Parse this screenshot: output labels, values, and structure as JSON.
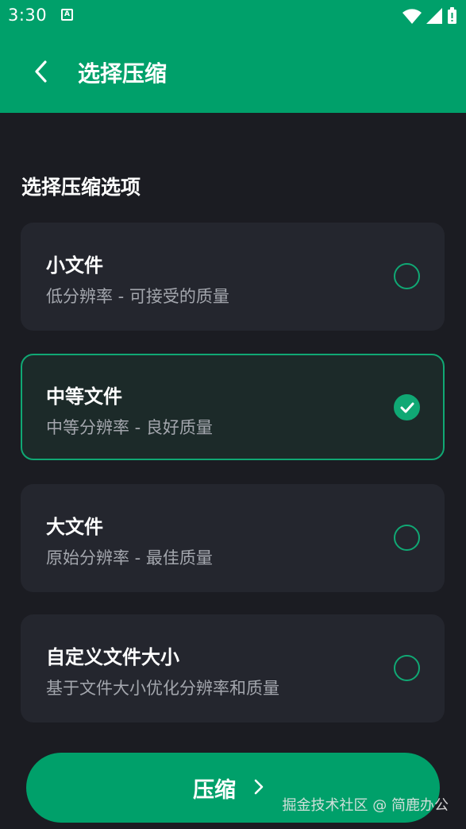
{
  "status_bar": {
    "time": "3:30",
    "notification_icon": "A",
    "icons": [
      "wifi-icon",
      "signal-icon",
      "battery-icon"
    ]
  },
  "app_bar": {
    "back_icon": "chevron-left-icon",
    "title": "选择压缩"
  },
  "section": {
    "title": "选择压缩选项"
  },
  "options": [
    {
      "title": "小文件",
      "desc": "低分辨率 - 可接受的质量",
      "selected": false
    },
    {
      "title": "中等文件",
      "desc": "中等分辨率 - 良好质量",
      "selected": true
    },
    {
      "title": "大文件",
      "desc": "原始分辨率 - 最佳质量",
      "selected": false
    },
    {
      "title": "自定义文件大小",
      "desc": "基于文件大小优化分辨率和质量",
      "selected": false
    }
  ],
  "compress_button": {
    "label": "压缩",
    "icon": "chevron-right-icon"
  },
  "watermark": "掘金技术社区 @ 简鹿办公",
  "colors": {
    "accent": "#00a06a",
    "background": "#1b1c22",
    "card": "#24262e",
    "selected_card": "#1c2a29",
    "secondary_text": "#a3a6ad"
  }
}
